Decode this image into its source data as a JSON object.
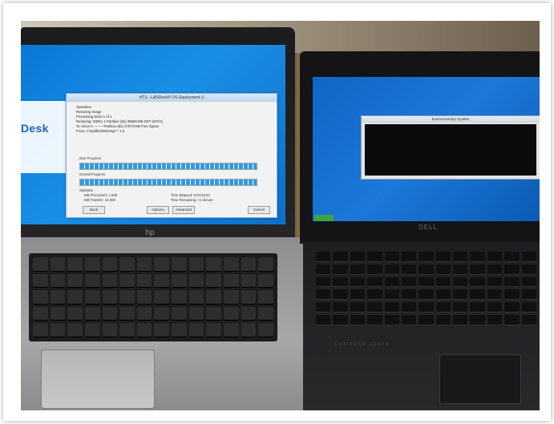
{
  "hp_laptop": {
    "brand_badge": "hp",
    "installer_window": {
      "title": "HTS - LANDesk® OS Deployment U",
      "logo_text": "Desk",
      "operation_heading": "Operation",
      "lines": [
        "Restoring Image",
        "Processing Drive 1 of 1",
        "Restoring: WDK1 1 Partition (81) 39999 MB GPT (W7/G)",
        "To: Drive 0 -------- Partition (81) 47973 MB Free Space",
        "From: J:\\Sysfiles\\WinImg\\*.* 1.6"
      ],
      "item_progress_label": "Item Progress",
      "overall_progress_label": "Overall Progress",
      "item_progress": 1.0,
      "overall_progress": 1.0,
      "statistics_label": "Statistics",
      "stats": {
        "mb_processed": "MB Processed: 1.538",
        "mb_per_minute": "MB Transfer: 10,398",
        "time_elapsed": "Time Elapsed: 0:04:03:03",
        "time_remaining": "Time Remaining: <1 minute"
      },
      "buttons": {
        "back": "Back",
        "options": "Options",
        "advanced": "Advanced",
        "cancel": "Cancel"
      }
    }
  },
  "dell_laptop": {
    "logo": "DELL",
    "brand": "LATITUDE E6420",
    "cmd_window_title": "Environment(x) System"
  },
  "colors": {
    "hp_desktop": "#1a8fe6",
    "dell_desktop": "#1c78d9",
    "progress_fill": "#2f9be6"
  }
}
